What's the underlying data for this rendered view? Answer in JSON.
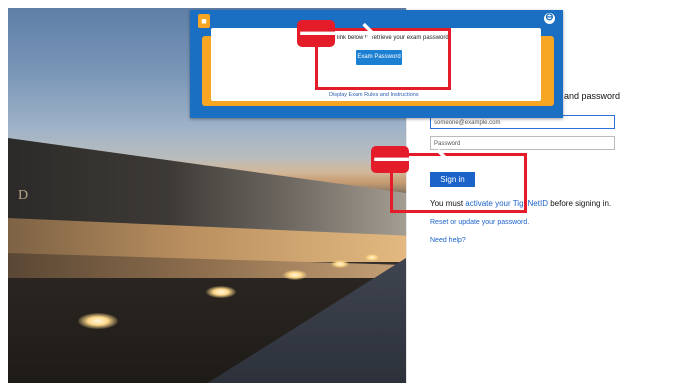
{
  "login": {
    "prompt_fragment": "and password",
    "email_placeholder": "someone@example.com",
    "password_placeholder": "Password",
    "signin_label": "Sign in",
    "must_prefix": "You must ",
    "must_link_a": "activate your Tig",
    "must_link_b": "NetID",
    "must_suffix": " before signing in.",
    "reset_link": "Reset or update your password.",
    "help_link": "Need help?"
  },
  "modal": {
    "instruction_fragment": "link below to retrieve your exam password.",
    "exam_button": "Exam Password",
    "rules_link": "Display Exam Rules and Instructions",
    "close_symbol": "⊖",
    "logo_icon": "proctor-logo-icon"
  },
  "photo": {
    "wall_letter": "D"
  },
  "annotations": {
    "arrow_symbol": "🡒",
    "color": "#e41c2a"
  }
}
